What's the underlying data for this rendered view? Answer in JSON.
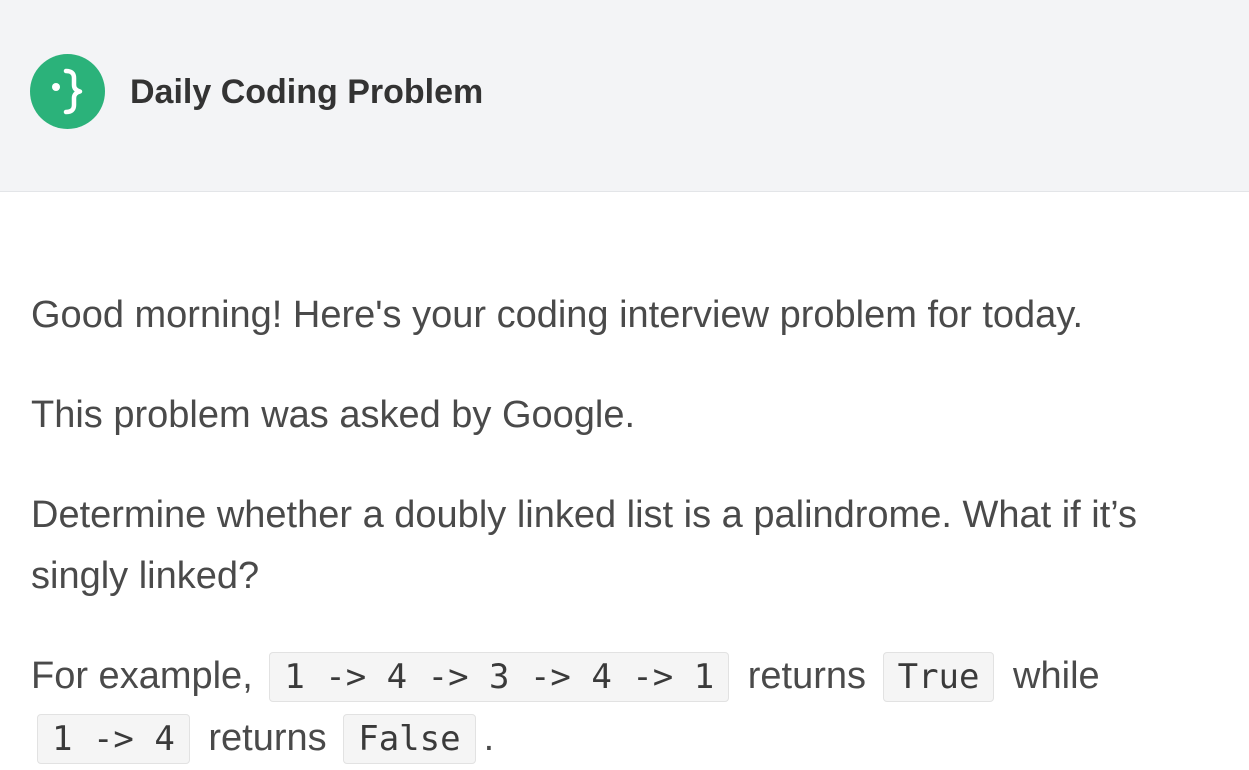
{
  "header": {
    "brand": "Daily Coding Problem",
    "logo_icon": "curly-brace-logo-icon",
    "logo_color": "#2bb27a"
  },
  "email": {
    "greeting": "Good morning! Here's your coding interview problem for today.",
    "asked_by": "This problem was asked by Google.",
    "problem": "Determine whether a doubly linked list is a palindrome. What if it’s singly linked?",
    "example": {
      "prefix": "For example,",
      "code1": "1 -> 4 -> 3 -> 4 -> 1",
      "mid1": "returns",
      "code2": "True",
      "mid2": "while",
      "code3": "1 -> 4",
      "mid3": "returns",
      "code4": "False",
      "suffix": "."
    }
  }
}
